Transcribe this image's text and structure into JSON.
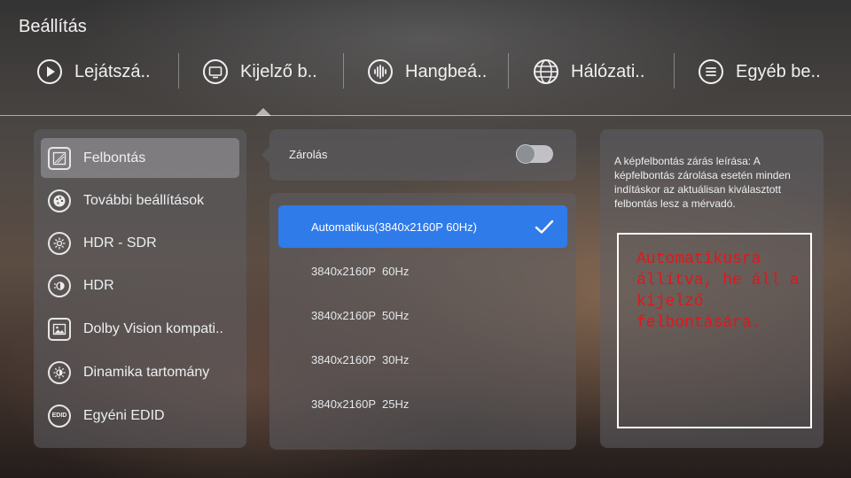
{
  "title": "Beállítás",
  "tabs": [
    {
      "label": "Lejátszá..",
      "icon": "play-circle-icon"
    },
    {
      "label": "Kijelző b..",
      "icon": "monitor-icon"
    },
    {
      "label": "Hangbeá..",
      "icon": "audio-wave-icon"
    },
    {
      "label": "Hálózati..",
      "icon": "globe-icon"
    },
    {
      "label": "Egyéb be..",
      "icon": "menu-list-icon"
    }
  ],
  "sidebar": {
    "items": [
      {
        "label": "Felbontás",
        "icon": "resolution-icon",
        "selected": true
      },
      {
        "label": "További beállítások",
        "icon": "palette-icon"
      },
      {
        "label": "HDR - SDR",
        "icon": "hdr-sdr-icon"
      },
      {
        "label": "HDR",
        "icon": "hdr-icon"
      },
      {
        "label": "Dolby Vision kompati..",
        "icon": "picture-icon"
      },
      {
        "label": "Dinamika tartomány",
        "icon": "brightness-icon"
      },
      {
        "label": "Egyéni EDID",
        "icon": "edid-icon",
        "badge": "EDID"
      }
    ]
  },
  "lock": {
    "label": "Zárolás",
    "enabled": false
  },
  "resolutions": {
    "options": [
      {
        "label": "Automatikus(3840x2160P 60Hz)",
        "selected": true
      },
      {
        "label": "3840x2160P  60Hz"
      },
      {
        "label": "3840x2160P  50Hz"
      },
      {
        "label": "3840x2160P  30Hz"
      },
      {
        "label": "3840x2160P  25Hz"
      }
    ],
    "selected_color": "#2f7bea"
  },
  "info": {
    "description": "A képfelbontás zárás leírása: A képfelbontás zárolása esetén minden indításkor az aktuálisan kiválasztott felbontás lesz a mérvadó.",
    "annotation": "Automatikusra állítva, he áll a kijelző felbontására.",
    "annotation_color": "#e0171c"
  }
}
